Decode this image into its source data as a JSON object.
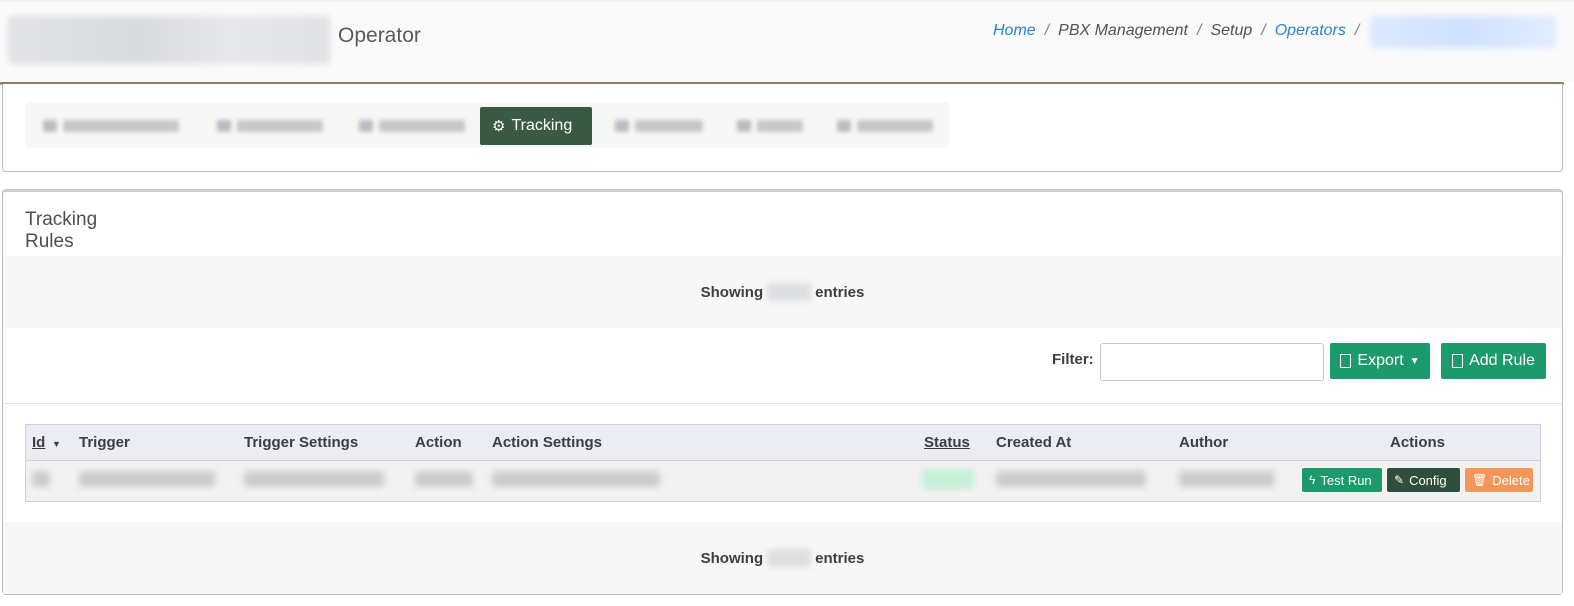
{
  "header": {
    "title": "Operator",
    "breadcrumb": {
      "home": "Home",
      "pbx_management": "PBX Management",
      "setup": "Setup",
      "operators": "Operators",
      "separator": "/"
    }
  },
  "tabs": {
    "active_label": "Tracking"
  },
  "section": {
    "title": "Tracking Rules"
  },
  "showing": {
    "prefix": "Showing",
    "suffix": "entries"
  },
  "filter": {
    "label": "Filter:",
    "value": ""
  },
  "buttons": {
    "export": "Export",
    "add_rule": "Add Rule"
  },
  "table": {
    "columns": {
      "id": "Id",
      "trigger": "Trigger",
      "trigger_settings": "Trigger Settings",
      "action": "Action",
      "action_settings": "Action Settings",
      "status": "Status",
      "created_at": "Created At",
      "author": "Author",
      "actions": "Actions"
    },
    "row_actions": {
      "test_run": "Test Run",
      "config": "Config",
      "delete": "Delete"
    }
  },
  "colors": {
    "accent_dark": "#3a5a43",
    "accent_green": "#1d9a6c",
    "delete_orange": "#f2965a",
    "link_blue": "#2a7fd4"
  }
}
